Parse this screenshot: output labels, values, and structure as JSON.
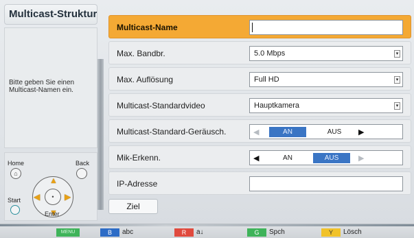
{
  "left_panel": {
    "title": "Multicast-Struktur.",
    "help_text_line1": "Bitte geben Sie einen",
    "help_text_line2": "Multicast-Namen ein."
  },
  "remote": {
    "home_label": "Home",
    "back_label": "Back",
    "start_label": "Start",
    "enter_label": "Enter"
  },
  "form": {
    "rows": [
      {
        "label": "Multicast-Name",
        "value": "",
        "kind": "text",
        "selected": true
      },
      {
        "label": "Max. Bandbr.",
        "value": "5.0 Mbps",
        "kind": "select"
      },
      {
        "label": "Max. Auflösung",
        "value": "Full HD",
        "kind": "select"
      },
      {
        "label": "Multicast-Standardvideo",
        "value": "Hauptkamera",
        "kind": "select"
      },
      {
        "label": "Multicast-Standard-Geräusch.",
        "kind": "toggle",
        "on": "AN",
        "off": "AUS",
        "selected_option": "AN"
      },
      {
        "label": "Mik-Erkenn.",
        "kind": "toggle",
        "on": "AN",
        "off": "AUS",
        "selected_option": "AUS"
      },
      {
        "label": "IP-Adresse",
        "value": "",
        "kind": "text"
      }
    ],
    "ziel_button": "Ziel"
  },
  "bottom_bar": {
    "menu_key": "MENU",
    "b_key": "B",
    "b_label": "abc",
    "r_key": "R",
    "r_label": "a↓",
    "g_key": "G",
    "g_label": "Spch",
    "y_key": "Y",
    "y_label": "Lösch"
  },
  "colors": {
    "selected_row": "#f4a934",
    "toggle_selected": "#3a75c4",
    "key_green": "#3fb35a",
    "key_blue": "#2d6cc6",
    "key_red": "#e04a3e",
    "key_yellow": "#f1c22a"
  }
}
